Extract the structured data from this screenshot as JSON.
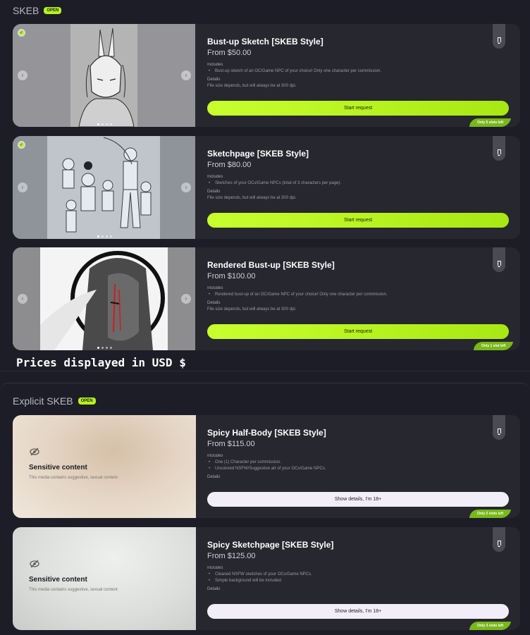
{
  "sections": {
    "skeb": {
      "title": "SKEB",
      "badge": "OPEN"
    },
    "explicit": {
      "title": "Explicit SKEB",
      "badge": "OPEN"
    }
  },
  "cards": [
    {
      "title": "Bust-up Sketch [SKEB Style]",
      "price": "From $50.00",
      "includes_label": "Includes",
      "includes": [
        "Bust-up sketch of an OC/Game NPC of your choice! Only one character per commission."
      ],
      "details_label": "Details",
      "details_fade": "File size depends, but will always be at 300 dpi.",
      "button": "Start request",
      "slots": "Only 5 slots left"
    },
    {
      "title": "Sketchpage [SKEB Style]",
      "price": "From $80.00",
      "includes_label": "Includes",
      "includes": [
        "Sketches of your OCs/Game NPCs (total of 3 characters per page)."
      ],
      "details_label": "Details",
      "details_fade": "File size depends, but will always be at 300 dpi.",
      "button": "Start request",
      "slots": ""
    },
    {
      "title": "Rendered Bust-up [SKEB Style]",
      "price": "From $100.00",
      "includes_label": "Includes",
      "includes": [
        "Rendered bust-up of an OC/Game NPC of your choice! Only one character per commission."
      ],
      "details_label": "Details",
      "details_fade": "File size depends, but will always be at 300 dpi.",
      "button": "Start request",
      "slots": "Only 1 slot left"
    },
    {
      "title": "Spicy Half-Body [SKEB Style]",
      "price": "From $115.00",
      "includes_label": "Includes",
      "includes": [
        "One (1) Character per commission.",
        "Uncolored NSFW/Suggestive art of your OCs/Game NPCs."
      ],
      "details_label": "Details",
      "details_fade": "",
      "button": "Show details, I'm 18+",
      "slots": "Only 2 slots left",
      "sensitive_title": "Sensitive content",
      "sensitive_sub": "This media contains suggestive, sexual content"
    },
    {
      "title": "Spicy Sketchpage [SKEB Style]",
      "price": "From $125.00",
      "includes_label": "Includes",
      "includes": [
        "Cleaned NSFW sketches of your OCs/Game NPCs.",
        "Simple background will be included."
      ],
      "details_label": "Details",
      "details_fade": "",
      "button": "Show details, I'm 18+",
      "slots": "Only 3 slots left",
      "sensitive_title": "Sensitive content",
      "sensitive_sub": "This media contains suggestive, sexual content"
    }
  ],
  "usd_note": "Prices displayed in USD $",
  "colors": {
    "accent": "#b6f31c",
    "card": "#27272f",
    "background": "#1d1d27",
    "slots": "#78b81a"
  }
}
